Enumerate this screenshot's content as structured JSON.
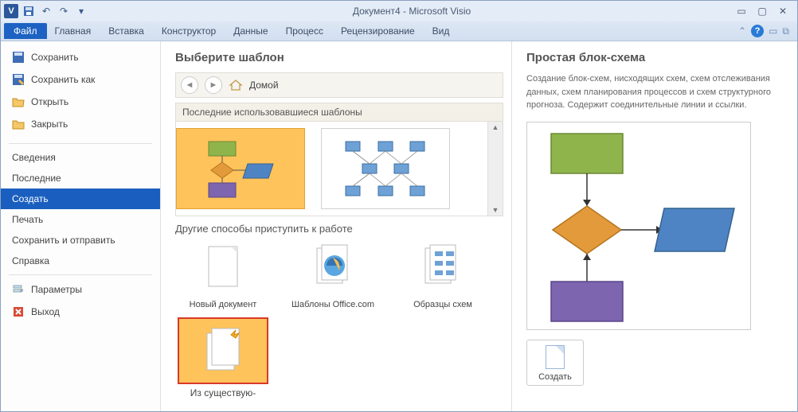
{
  "title": "Документ4 - Microsoft Visio",
  "ribbon": {
    "file": "Файл",
    "tabs": [
      "Главная",
      "Вставка",
      "Конструктор",
      "Данные",
      "Процесс",
      "Рецензирование",
      "Вид"
    ]
  },
  "sidebar": {
    "save": "Сохранить",
    "save_as": "Сохранить как",
    "open": "Открыть",
    "close": "Закрыть",
    "info": "Сведения",
    "recent": "Последние",
    "create": "Создать",
    "print": "Печать",
    "send": "Сохранить и отправить",
    "help": "Справка",
    "options": "Параметры",
    "exit": "Выход"
  },
  "mid": {
    "heading": "Выберите шаблон",
    "home": "Домой",
    "recent_templates": "Последние использовавшиеся шаблоны",
    "other_ways": "Другие способы приступить к работе",
    "new_doc": "Новый документ",
    "office_templates": "Шаблоны Office.com",
    "sample": "Образцы схем",
    "from_existing": "Из существую-"
  },
  "right": {
    "heading": "Простая блок-схема",
    "desc": "Создание блок-схем, нисходящих схем, схем отслеживания данных, схем планирования процессов и схем структурного прогноза. Содержит соединительные линии и ссылки.",
    "create": "Создать"
  }
}
